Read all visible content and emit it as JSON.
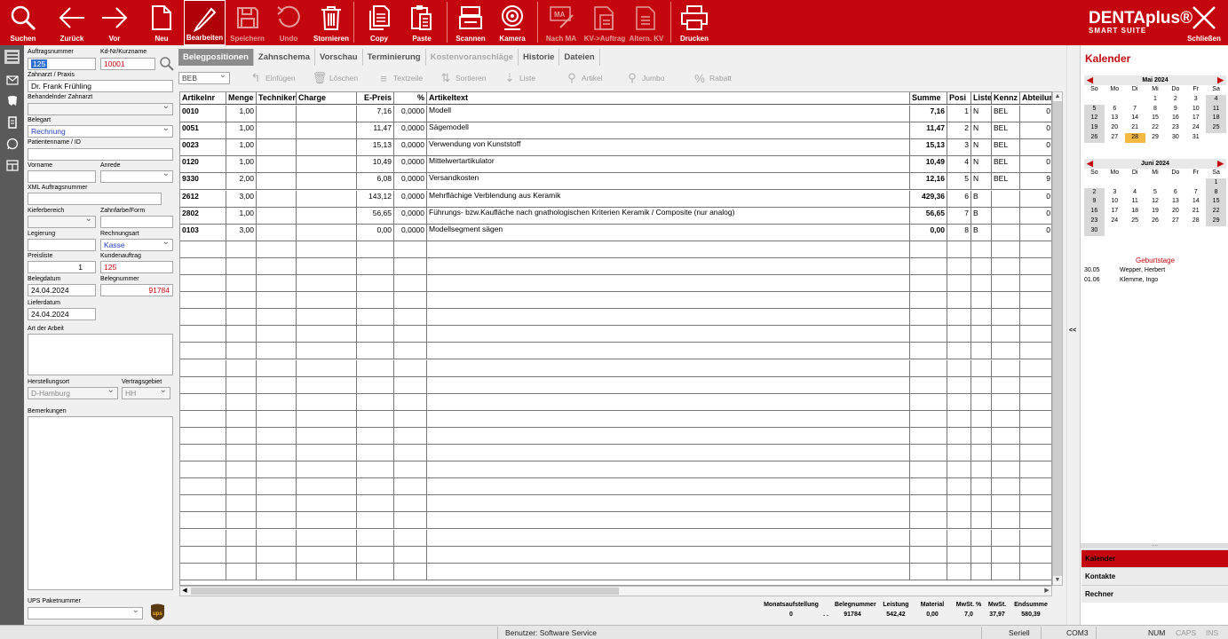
{
  "toolbar": {
    "buttons": [
      {
        "label": "Suchen",
        "icon": "search-icon"
      },
      {
        "label": "Zurück",
        "icon": "arrow-left-icon"
      },
      {
        "label": "Vor",
        "icon": "arrow-right-icon"
      },
      {
        "label": "Neu",
        "icon": "new-document-icon"
      },
      {
        "label": "Bearbeiten",
        "icon": "edit-pencil-icon"
      },
      {
        "label": "Speichern",
        "icon": "save-icon"
      },
      {
        "label": "Undo",
        "icon": "undo-icon"
      },
      {
        "label": "Stornieren",
        "icon": "trash-icon"
      },
      {
        "label": "Copy",
        "icon": "copy-icon"
      },
      {
        "label": "Paste",
        "icon": "paste-icon"
      },
      {
        "label": "Scannen",
        "icon": "scanner-icon"
      },
      {
        "label": "Kamera",
        "icon": "camera-icon"
      },
      {
        "label": "Nach MA",
        "icon": "ma-sign-icon"
      },
      {
        "label": "KV->Auftrag",
        "icon": "calculator-doc-icon"
      },
      {
        "label": "Altern. KV",
        "icon": "alt-calculator-icon"
      },
      {
        "label": "Drucken",
        "icon": "printer-icon"
      }
    ],
    "close_label": "Schließen",
    "brand_main": "DENTAplus®",
    "brand_sub": "SMART SUITE"
  },
  "form": {
    "auftragsnummer_label": "Auftragsnummer",
    "auftragsnummer": "125",
    "kdnr_label": "Kd-Nr/Kurzname",
    "kdnr": "10001",
    "zahnarzt_label": "Zahnarzt / Praxis",
    "zahnarzt": "Dr. Frank Frühling",
    "behandelnder_label": "Behandelnder Zahnarzt",
    "behandelnder": "",
    "belegart_label": "Belegart",
    "belegart": "Rechnung",
    "patient_label": "Patientenname / ID",
    "patient": "",
    "vorname_label": "Vorname",
    "vorname": "",
    "anrede_label": "Anrede",
    "anrede": "",
    "xml_label": "XML Auftragsnummer",
    "xml": "",
    "kieferbereich_label": "Kieferbereich",
    "kieferbereich": "",
    "zahnfarbe_label": "Zahnfarbe/Form",
    "zahnfarbe": "",
    "legierung_label": "Legierung",
    "legierung": "",
    "rechnungsart_label": "Rechnungsart",
    "rechnungsart": "Kasse",
    "preisliste_label": "Preisliste",
    "preisliste": "1",
    "kundenauftrag_label": "Kundenauftrag",
    "kundenauftrag": "125",
    "belegdatum_label": "Belegdatum",
    "belegdatum": "24.04.2024",
    "belegnummer_label": "Belegnummer",
    "belegnummer": "91784",
    "lieferdatum_label": "Lieferdatum",
    "lieferdatum": "24.04.2024",
    "artderarbeit_label": "Art der Arbeit",
    "herstellungsort_label": "Herstellungsort",
    "herstellungsort": "D-Hamburg",
    "vertragsgebiet_label": "Vertragsgebiet",
    "vertragsgebiet": "HH",
    "bemerkungen_label": "Bemerkungen",
    "ups_label": "UPS Paketnummer",
    "ups": ""
  },
  "tabs": [
    "Belegpositionen",
    "Zahnschema",
    "Vorschau",
    "Terminierung",
    "Kostenvoranschläge",
    "Historie",
    "Dateien"
  ],
  "subtoolbar": {
    "beb": "BEB",
    "einfuegen": "Einfügen",
    "loeschen": "Löschen",
    "textzeile": "Textzeile",
    "sortieren": "Sortieren",
    "liste": "Liste",
    "artikel": "Artikel",
    "jumbo": "Jumbo",
    "rabatt": "Rabatt"
  },
  "grid": {
    "headers": [
      "Artikelnr",
      "Menge",
      "Techniker",
      "Charge",
      "E-Preis",
      "%",
      "Artikeltext",
      "Summe",
      "Posi",
      "Liste",
      "Kennz",
      "Abteilun"
    ],
    "rows": [
      [
        "0010",
        "1,00",
        "",
        "",
        "7,16",
        "0,0000",
        "Modell",
        "7,16",
        "1",
        "N",
        "BEL",
        "0"
      ],
      [
        "0051",
        "1,00",
        "",
        "",
        "11,47",
        "0,0000",
        "Sägemodell",
        "11,47",
        "2",
        "N",
        "BEL",
        "0"
      ],
      [
        "0023",
        "1,00",
        "",
        "",
        "15,13",
        "0,0000",
        "Verwendung von Kunststoff",
        "15,13",
        "3",
        "N",
        "BEL",
        "0"
      ],
      [
        "0120",
        "1,00",
        "",
        "",
        "10,49",
        "0,0000",
        "Mittelwertartikulator",
        "10,49",
        "4",
        "N",
        "BEL",
        "0"
      ],
      [
        "9330",
        "2,00",
        "",
        "",
        "6,08",
        "0,0000",
        "Versandkosten",
        "12,16",
        "5",
        "N",
        "BEL",
        "9"
      ],
      [
        "2612",
        "3,00",
        "",
        "",
        "143,12",
        "0,0000",
        "Mehrflächige Verblendung aus Keramik",
        "429,36",
        "6",
        "B",
        "",
        "0"
      ],
      [
        "2802",
        "1,00",
        "",
        "",
        "56,65",
        "0,0000",
        "Führungs- bzw.Kaufläche nach gnathologischen Kriterien Keramik / Composite (nur analog)",
        "56,65",
        "7",
        "B",
        "",
        "0"
      ],
      [
        "0103",
        "3,00",
        "",
        "",
        "0,00",
        "0,0000",
        "Modellsegment sägen",
        "0,00",
        "8",
        "B",
        "",
        "0"
      ]
    ]
  },
  "totals": {
    "labels": [
      "Monatsaufstellung",
      "Belegnummer",
      "Leistung",
      "Material",
      "MwSt. %",
      "MwSt.",
      "Endsumme"
    ],
    "values": [
      "0",
      ". .",
      "91784",
      "542,42",
      "0,00",
      "7,0",
      "37,97",
      "580,39"
    ]
  },
  "right_panel": {
    "title": "Kalender",
    "weekdays": [
      "So",
      "Mo",
      "Di",
      "Mi",
      "Do",
      "Fr",
      "Sa"
    ],
    "month1": {
      "name": "Mai 2024",
      "offset": 3,
      "days": 31,
      "weekend_rows_start": 5,
      "today": 28
    },
    "month2": {
      "name": "Juni 2024",
      "offset": 6,
      "days": 30,
      "weekend_rows_start": 2,
      "today": 0
    },
    "birthdays_title": "Geburtstage",
    "birthdays": [
      {
        "date": "30.05",
        "name": "Wepper, Herbert"
      },
      {
        "date": "01.06",
        "name": "Klemme, Ingo"
      }
    ],
    "buttons": [
      "Kalender",
      "Kontakte",
      "Rechner"
    ],
    "collapse_label": "<<"
  },
  "status": {
    "user": "Benutzer: Software Service",
    "port1": "Seriell",
    "port2": "COM3",
    "num": "NUM",
    "caps": "CAPS",
    "ins": "INS"
  },
  "colors": {
    "accent": "#c4070f"
  }
}
